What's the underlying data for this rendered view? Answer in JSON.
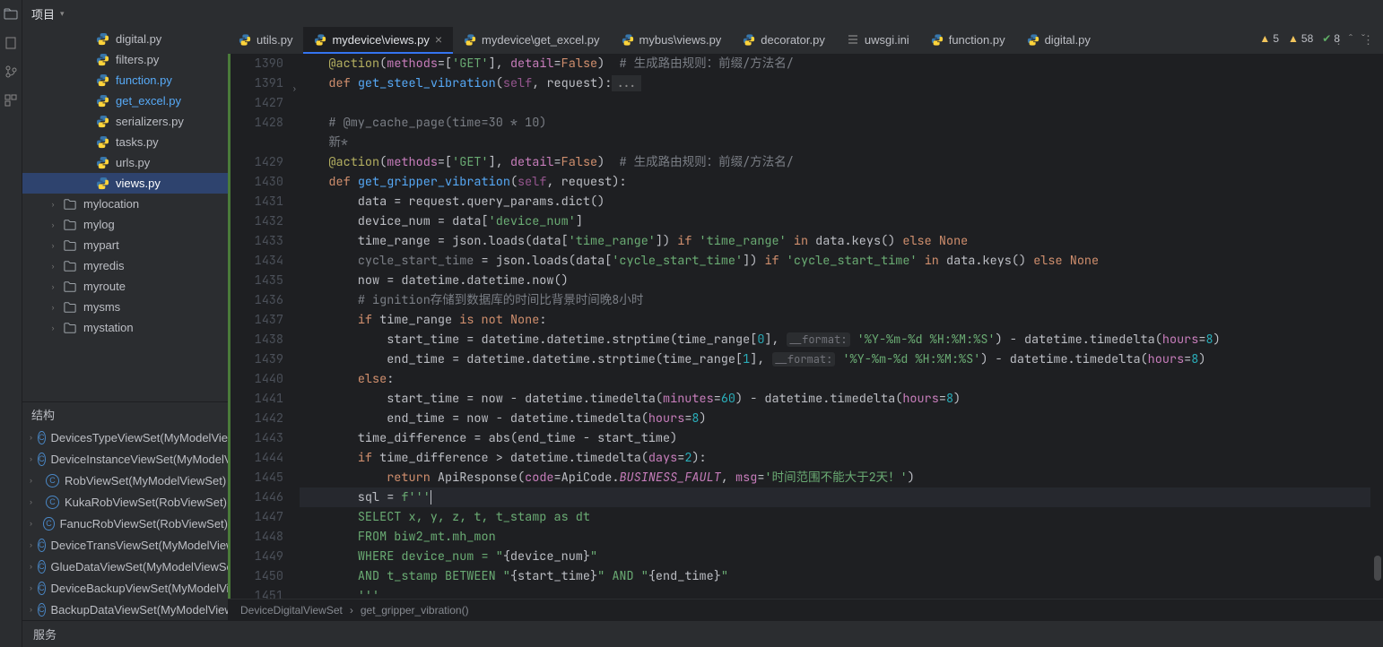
{
  "project_label": "项目",
  "structure_label": "结构",
  "services_label": "服务",
  "status": {
    "warn_a": "5",
    "warn_b": "58",
    "ok": "8"
  },
  "tabs": [
    {
      "label": "utils.py",
      "icon": "py"
    },
    {
      "label": "mydevice\\views.py",
      "icon": "py",
      "active": true,
      "close": true
    },
    {
      "label": "mydevice\\get_excel.py",
      "icon": "py"
    },
    {
      "label": "mybus\\views.py",
      "icon": "py"
    },
    {
      "label": "decorator.py",
      "icon": "py"
    },
    {
      "label": "uwsgi.ini",
      "icon": "ini"
    },
    {
      "label": "function.py",
      "icon": "py"
    },
    {
      "label": "digital.py",
      "icon": "py"
    }
  ],
  "tree": [
    {
      "indent": 3,
      "icon": "py",
      "name": "digital.py"
    },
    {
      "indent": 3,
      "icon": "py",
      "name": "filters.py"
    },
    {
      "indent": 3,
      "icon": "py",
      "name": "function.py",
      "hl": true
    },
    {
      "indent": 3,
      "icon": "py",
      "name": "get_excel.py",
      "hl": true
    },
    {
      "indent": 3,
      "icon": "py",
      "name": "serializers.py"
    },
    {
      "indent": 3,
      "icon": "py",
      "name": "tasks.py"
    },
    {
      "indent": 3,
      "icon": "py",
      "name": "urls.py"
    },
    {
      "indent": 3,
      "icon": "py",
      "name": "views.py",
      "sel": true
    },
    {
      "indent": 1,
      "icon": "dir",
      "name": "mylocation",
      "arrow": true
    },
    {
      "indent": 1,
      "icon": "dir",
      "name": "mylog",
      "arrow": true
    },
    {
      "indent": 1,
      "icon": "dir",
      "name": "mypart",
      "arrow": true
    },
    {
      "indent": 1,
      "icon": "dir",
      "name": "myredis",
      "arrow": true
    },
    {
      "indent": 1,
      "icon": "dir",
      "name": "myroute",
      "arrow": true
    },
    {
      "indent": 1,
      "icon": "dir",
      "name": "mysms",
      "arrow": true
    },
    {
      "indent": 1,
      "icon": "dir",
      "name": "mystation",
      "arrow": true
    }
  ],
  "struct": [
    {
      "name": "DevicesTypeViewSet(MyModelViewSet)"
    },
    {
      "name": "DeviceInstanceViewSet(MyModelViewSet)"
    },
    {
      "name": "RobViewSet(MyModelViewSet)"
    },
    {
      "name": "KukaRobViewSet(RobViewSet)"
    },
    {
      "name": "FanucRobViewSet(RobViewSet)"
    },
    {
      "name": "DeviceTransViewSet(MyModelViewSet)"
    },
    {
      "name": "GlueDataViewSet(MyModelViewSet)"
    },
    {
      "name": "DeviceBackupViewSet(MyModelViewSet)"
    },
    {
      "name": "BackupDataViewSet(MyModelViewSet)"
    }
  ],
  "breadcrumb": [
    "DeviceDigitalViewSet",
    "get_gripper_vibration()"
  ],
  "code": {
    "lines": [
      {
        "n": "1390",
        "html": "    <span class='c-dec'>@action</span>(<span class='c-field'>methods</span>=[<span class='c-str'>'GET'</span>], <span class='c-field'>detail</span>=<span class='c-bool'>False</span>)  <span class='c-cmt'># 生成路由规则：前缀/方法名/</span>"
      },
      {
        "n": "1391",
        "fold": true,
        "html": "    <span class='c-kw'>def</span> <span class='c-def'>get_steel_vibration</span>(<span class='c-self'>self</span>, request):<span style='background:#2b2d30;color:#888;padding:0 4px;'>...</span>"
      },
      {
        "n": "1427",
        "html": ""
      },
      {
        "n": "1428",
        "html": "    <span class='c-cmt'># @my_cache_page(time=30 * 10)</span>"
      },
      {
        "n": "",
        "html": "    <span class='c-cmt'>新*</span>"
      },
      {
        "n": "1429",
        "html": "    <span class='c-dec'>@action</span>(<span class='c-field'>methods</span>=[<span class='c-str'>'GET'</span>], <span class='c-field'>detail</span>=<span class='c-bool'>False</span>)  <span class='c-cmt'># 生成路由规则：前缀/方法名/</span>"
      },
      {
        "n": "1430",
        "html": "    <span class='c-kw'>def</span> <span class='c-def'>get_gripper_vibration</span>(<span class='c-self'>self</span>, request):"
      },
      {
        "n": "1431",
        "html": "        data = request.query_params.dict()"
      },
      {
        "n": "1432",
        "html": "        device_num = data[<span class='c-str'>'device_num'</span>]"
      },
      {
        "n": "1433",
        "html": "        time_range = json.loads(data[<span class='c-str'>'time_range'</span>]) <span class='c-kw'>if</span> <span class='c-str'>'time_range'</span> <span class='c-kw'>in</span> data.keys() <span class='c-kw'>else</span> <span class='c-bool'>None</span>"
      },
      {
        "n": "1434",
        "html": "        <span class='c-cmt'>cycle_start_time</span> = json.loads(data[<span class='c-str'>'cycle_start_time'</span>]) <span class='c-kw'>if</span> <span class='c-str'>'cycle_start_time'</span> <span class='c-kw'>in</span> data.keys() <span class='c-kw'>else</span> <span class='c-bool'>None</span>"
      },
      {
        "n": "1435",
        "html": "        now = datetime.datetime.now()"
      },
      {
        "n": "1436",
        "html": "        <span class='c-cmt'># ignition存储到数据库的时间比背景时间晚8小时</span>"
      },
      {
        "n": "1437",
        "html": "        <span class='c-kw'>if</span> time_range <span class='c-kw'>is not</span> <span class='c-bool'>None</span>:"
      },
      {
        "n": "1438",
        "html": "            start_time = datetime.datetime.strptime(time_range[<span class='c-num'>0</span>], <span class='c-prm'>__format:</span> <span class='c-str'>'%Y-%m-%d %H:%M:%S'</span>) - datetime.timedelta(<span class='c-field'>hours</span>=<span class='c-num'>8</span>)"
      },
      {
        "n": "1439",
        "html": "            end_time = datetime.datetime.strptime(time_range[<span class='c-num'>1</span>], <span class='c-prm'>__format:</span> <span class='c-str'>'%Y-%m-%d %H:%M:%S'</span>) - datetime.timedelta(<span class='c-field'>hours</span>=<span class='c-num'>8</span>)"
      },
      {
        "n": "1440",
        "html": "        <span class='c-kw'>else</span>:"
      },
      {
        "n": "1441",
        "html": "            start_time = now - datetime.timedelta(<span class='c-field'>minutes</span>=<span class='c-num'>60</span>) - datetime.timedelta(<span class='c-field'>hours</span>=<span class='c-num'>8</span>)"
      },
      {
        "n": "1442",
        "html": "            end_time = now - datetime.timedelta(<span class='c-field'>hours</span>=<span class='c-num'>8</span>)"
      },
      {
        "n": "1443",
        "html": "        time_difference = abs(end_time - start_time)"
      },
      {
        "n": "1444",
        "html": "        <span class='c-kw'>if</span> time_difference &gt; datetime.timedelta(<span class='c-field'>days</span>=<span class='c-num'>2</span>):"
      },
      {
        "n": "1445",
        "html": "            <span class='c-kw'>return</span> ApiResponse(<span class='c-field'>code</span>=ApiCode.<span class='c-const'>BUSINESS_FAULT</span>, <span class='c-field'>msg</span>=<span class='c-str'>'时间范围不能大于2天！'</span>)"
      },
      {
        "n": "1446",
        "cursor": true,
        "html": "        sql = <span class='c-str'>f'''</span><span class='caret'></span>"
      },
      {
        "n": "1447",
        "html": "        <span class='c-str'>SELECT x, y, z, t, t_stamp as dt</span>"
      },
      {
        "n": "1448",
        "html": "        <span class='c-str'>FROM biw2_mt.mh_mon</span>"
      },
      {
        "n": "1449",
        "html": "        <span class='c-str'>WHERE device_num = \"</span>{device_num}<span class='c-str'>\"</span>"
      },
      {
        "n": "1450",
        "html": "        <span class='c-str'>AND t_stamp BETWEEN \"</span>{start_time}<span class='c-str'>\" AND \"</span>{end_time}<span class='c-str'>\"</span>"
      },
      {
        "n": "1451",
        "html": "        <span class='c-str'>'''</span>"
      }
    ]
  }
}
